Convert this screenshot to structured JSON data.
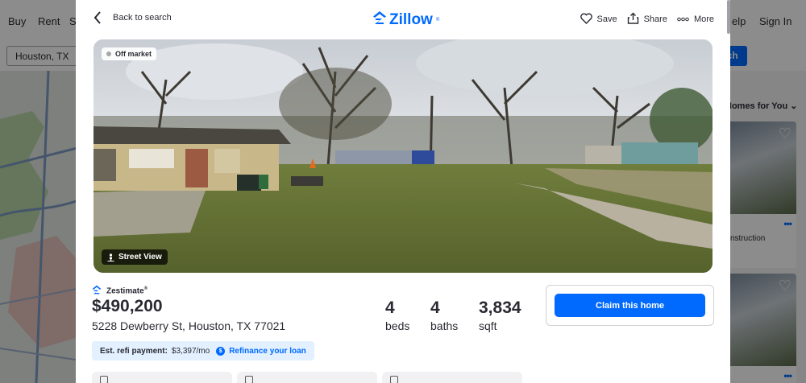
{
  "background": {
    "nav": [
      "Buy",
      "Rent",
      "S",
      "elp",
      "Sign In"
    ],
    "search_value": "Houston, TX",
    "search_button": "rch",
    "homes_title": "Homes for You",
    "card_text": "nstruction"
  },
  "modal": {
    "back_label": "Back to search",
    "logo": "Zillow",
    "logo_mark": "®",
    "actions": {
      "save": "Save",
      "share": "Share",
      "more": "More"
    },
    "photo": {
      "status_badge": "Off market",
      "street_view": "Street View"
    },
    "zestimate_label": "Zestimate",
    "zestimate_mark": "®",
    "price": "$490,200",
    "address": "5228 Dewberry St, Houston, TX 77021",
    "stats": [
      {
        "value": "4",
        "label": "beds"
      },
      {
        "value": "4",
        "label": "baths"
      },
      {
        "value": "3,834",
        "label": "sqft"
      }
    ],
    "claim_button": "Claim this home",
    "refi": {
      "label": "Est. refi payment:",
      "value": "$3,397/mo",
      "coin": "$",
      "link": "Refinance your loan"
    }
  },
  "colors": {
    "brand": "#006aff",
    "text": "#2a2a33",
    "refi_bg": "#e2f0ff"
  }
}
